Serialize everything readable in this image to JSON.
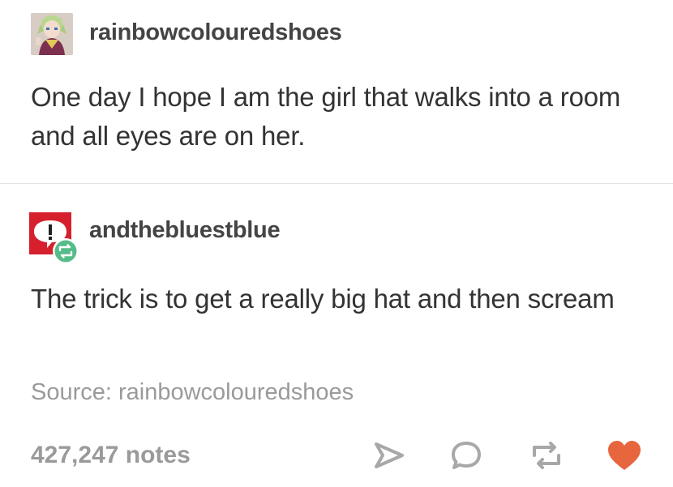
{
  "posts": [
    {
      "username": "rainbowcolouredshoes",
      "text": "One day I hope I am the girl that walks into a room and all eyes are on her.",
      "avatar_icon": "anime-character-avatar"
    },
    {
      "username": "andthebluestblue",
      "text": "The trick is to get a really big hat and then scream",
      "avatar_icon": "alert-speech-bubble-avatar",
      "badge_icon": "reblog-badge-icon"
    }
  ],
  "source": "Source: rainbowcolouredshoes",
  "notes": "427,247 notes",
  "actions": {
    "share_icon": "share-icon",
    "reply_icon": "reply-icon",
    "reblog_icon": "reblog-icon",
    "like_icon": "heart-icon"
  },
  "colors": {
    "text": "#333333",
    "muted": "#9a9a9a",
    "like": "#e8663d",
    "avatar_red": "#d6202e",
    "reblog_green": "#56bc8a"
  }
}
